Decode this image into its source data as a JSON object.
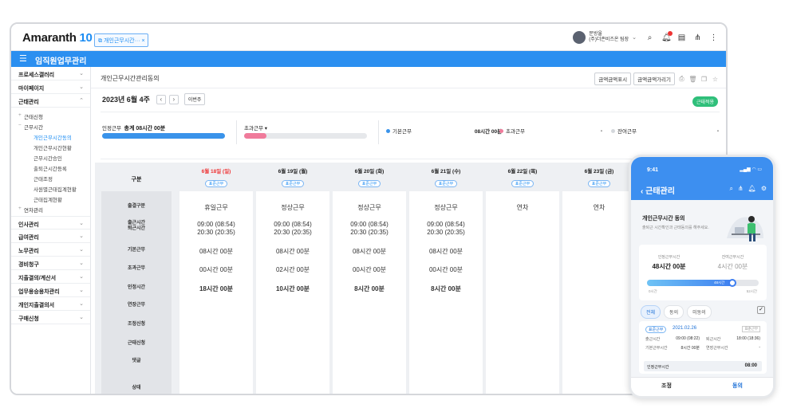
{
  "app": {
    "logo": "Amaranth",
    "logo_num": "10",
    "tab_chip": "개인근무시간···",
    "tab_close": "×"
  },
  "user": {
    "name": "문방울",
    "org": "(주)더존비즈온 팀장"
  },
  "module_title": "임직원업무관리",
  "sidebar": {
    "items": [
      {
        "label": "프로세스갤러리"
      },
      {
        "label": "마이페이지"
      },
      {
        "label": "근태관리"
      }
    ],
    "sub": [
      {
        "label": "근태신청"
      },
      {
        "label": "근무시간"
      }
    ],
    "l2": [
      {
        "label": "개인근무시간동의"
      },
      {
        "label": "개인근무시간현황"
      },
      {
        "label": "근무시간승인"
      },
      {
        "label": "출퇴근시간등록"
      },
      {
        "label": "근태조정"
      },
      {
        "label": "사원별근태집계현황"
      },
      {
        "label": "근태집계현황"
      }
    ],
    "sub2": [
      {
        "label": "연차관리"
      }
    ],
    "items2": [
      {
        "label": "인사관리"
      },
      {
        "label": "급여관리"
      },
      {
        "label": "노무관리"
      },
      {
        "label": "경비청구"
      },
      {
        "label": "지출결의/계산서"
      },
      {
        "label": "업무용승용차관리"
      },
      {
        "label": "개인지출결의서"
      },
      {
        "label": "구매신청"
      }
    ]
  },
  "page": {
    "title": "개인근무시간관리동의",
    "btn_print": "금액금액표시",
    "btn_hide": "금액금액가리기",
    "week": "2023년 6월 4주",
    "prev_week": "이번주",
    "status_badge": "근태적용"
  },
  "summary": {
    "recognized_label": "인정근무",
    "recognized_total": "총계 08시간 00분",
    "recognized_progress": 1.0,
    "overtime_label": "초과근무",
    "overtime_progress": 0.18,
    "legend": [
      {
        "label": "기본근무",
        "value": "08시간 00분",
        "color": "#3a93ea"
      },
      {
        "label": "초과근무",
        "value": "-",
        "color": "#f07b9b"
      },
      {
        "label": "잔여근무",
        "value": "-",
        "color": "#d5d8dc"
      }
    ]
  },
  "grid": {
    "gubun": "구분",
    "rows": [
      "출결구분",
      "출근시간\n퇴근시간",
      "기본근무",
      "초과근무",
      "인정시간",
      "연장근무",
      "조정신청",
      "근태신청",
      "댓글",
      "상태"
    ],
    "days": [
      {
        "date": "6월 18일 (일)",
        "pill": "표준근무",
        "sun": true,
        "type": "휴일근무",
        "times": "09:00 (08:54)\n20:30 (20:35)",
        "base": "08시간 00분",
        "over": "00시간 00분",
        "recog": "18시간 00분"
      },
      {
        "date": "6월 19일 (월)",
        "pill": "표준근무",
        "sun": false,
        "type": "정상근무",
        "times": "09:00 (08:54)\n20:30 (20:35)",
        "base": "08시간 00분",
        "over": "02시간 00분",
        "recog": "10시간 00분"
      },
      {
        "date": "6월 20일 (화)",
        "pill": "표준근무",
        "sun": false,
        "type": "정상근무",
        "times": "09:00 (08:54)\n20:30 (20:35)",
        "base": "08시간 00분",
        "over": "00시간 00분",
        "recog": "8시간 00분"
      },
      {
        "date": "6월 21일 (수)",
        "pill": "표준근무",
        "sun": false,
        "type": "정상근무",
        "times": "09:00 (08:54)\n20:30 (20:35)",
        "base": "08시간 00분",
        "over": "00시간 00분",
        "recog": "8시간 00분"
      },
      {
        "date": "6월 22일 (목)",
        "pill": "표준근무",
        "sun": false,
        "type": "연차",
        "times": "",
        "base": "",
        "over": "",
        "recog": ""
      },
      {
        "date": "6월 23일 (금)",
        "pill": "표준근무",
        "sun": false,
        "type": "연차",
        "times": "",
        "base": "",
        "over": "",
        "recog": ""
      }
    ]
  },
  "phone": {
    "time": "9:41",
    "title": "근태관리",
    "heading": "개인근무시간 동의",
    "subheading": "출퇴근 시간확인과 근태동의를 해주세요.",
    "card_left_label": "인정근무시간",
    "card_left_value": "48시간 00분",
    "card_right_label": "잔여근무시간",
    "card_right_value": "4시간 00분",
    "bar_label": "48시간",
    "bar_min": "0시간",
    "bar_max": "52시간",
    "bar_progress": 0.78,
    "tabs": [
      "전체",
      "동의",
      "미동의"
    ],
    "item_badge": "표준근무",
    "item_date": "2021.02.26",
    "item_tag": "표준근무",
    "rows": [
      {
        "l1": "출근시간",
        "v1": "09:00 (08:22)",
        "l2": "퇴근시간",
        "v2": "18:00 (18:36)"
      },
      {
        "l1": "기본근무시간",
        "v1": "8시간 00분",
        "l2": "연장근무시간",
        "v2": "-"
      }
    ],
    "recog_label": "인정근무시간",
    "recog_value": "08:00",
    "btn_adjust": "조정",
    "btn_agree": "동의"
  },
  "colors": {
    "accent": "#2b8ff0",
    "sunday": "#e33333",
    "green": "#2fbf7a"
  }
}
